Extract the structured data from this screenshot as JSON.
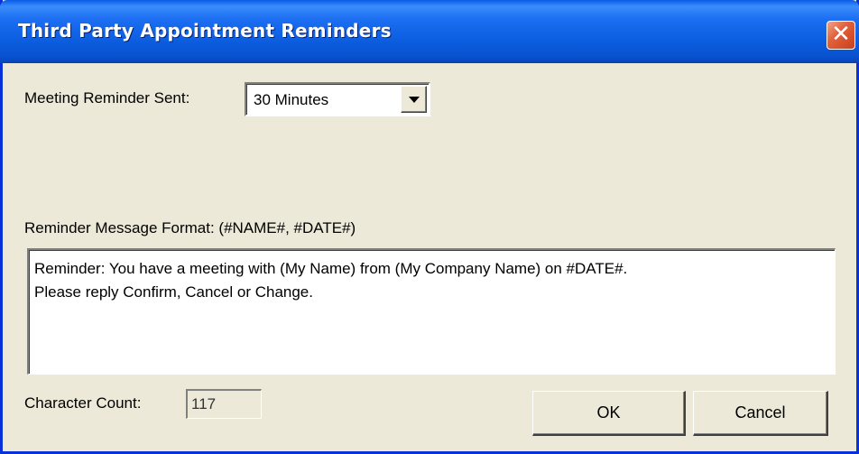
{
  "window": {
    "title": "Third Party Appointment Reminders",
    "close_glyph": "✕"
  },
  "reminder_sent": {
    "label": "Meeting Reminder Sent:",
    "selected": "30 Minutes"
  },
  "message_format": {
    "label": "Reminder Message Format: (#NAME#, #DATE#)",
    "text": "Reminder: You have a meeting with (My Name) from (My Company Name) on #DATE#.\nPlease reply Confirm, Cancel or Change."
  },
  "character_count": {
    "label": "Character Count:",
    "value": "117"
  },
  "buttons": {
    "ok_label": "OK",
    "cancel_label": "Cancel"
  },
  "colors": {
    "titlebar": "#0a5bdc",
    "dialog_bg": "#ece9d8",
    "close_button": "#e2613c"
  }
}
